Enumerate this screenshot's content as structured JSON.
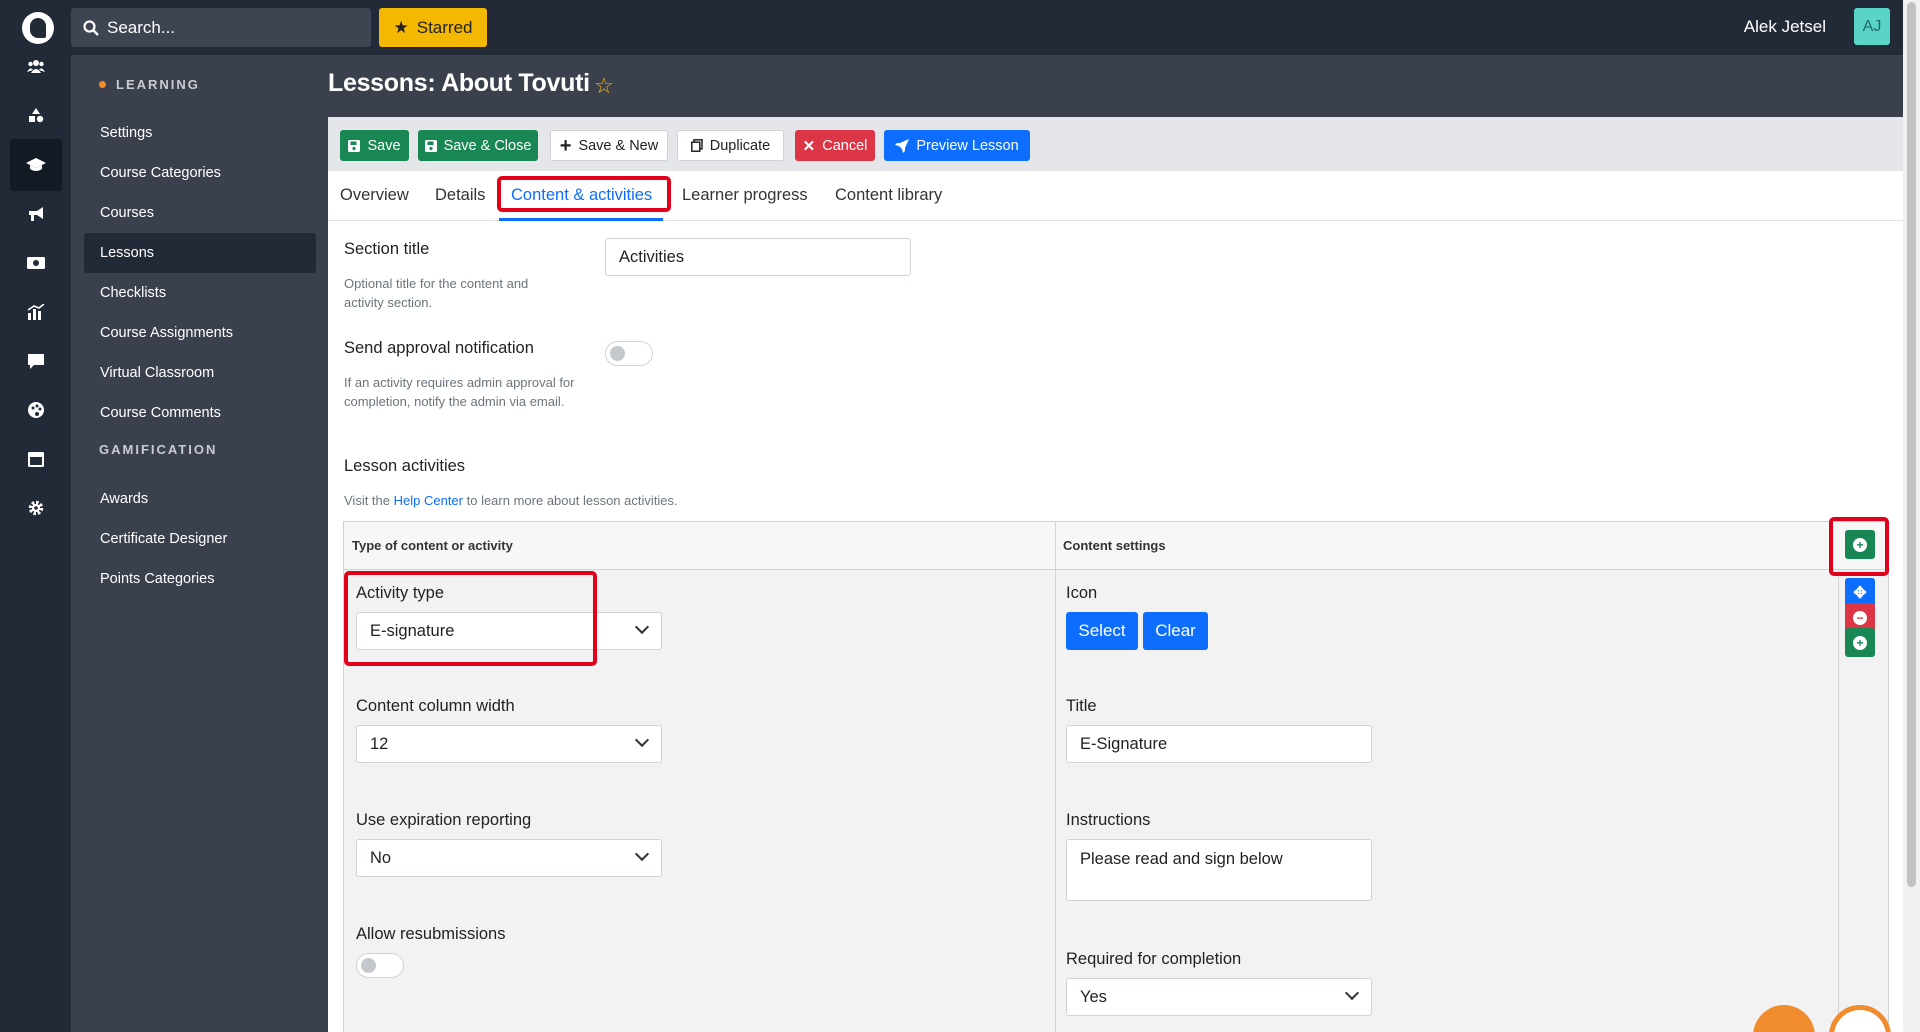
{
  "topbar": {
    "search_placeholder": "Search...",
    "starred_label": "Starred",
    "user_name": "Alek Jetsel",
    "user_initials": "AJ"
  },
  "sidebar": {
    "learning_header": "LEARNING",
    "learning_items": [
      {
        "label": "Settings"
      },
      {
        "label": "Course Categories"
      },
      {
        "label": "Courses"
      },
      {
        "label": "Lessons"
      },
      {
        "label": "Checklists"
      },
      {
        "label": "Course Assignments"
      },
      {
        "label": "Virtual Classroom"
      },
      {
        "label": "Course Comments"
      }
    ],
    "gamification_header": "GAMIFICATION",
    "gamification_items": [
      {
        "label": "Awards"
      },
      {
        "label": "Certificate Designer"
      },
      {
        "label": "Points Categories"
      }
    ],
    "active_item": "Lessons"
  },
  "page": {
    "title": "Lessons: About Tovuti"
  },
  "toolbar": {
    "save": "Save",
    "save_close": "Save & Close",
    "save_new": "Save & New",
    "duplicate": "Duplicate",
    "cancel": "Cancel",
    "preview": "Preview Lesson"
  },
  "tabs": {
    "overview": "Overview",
    "details": "Details",
    "content": "Content & activities",
    "progress": "Learner progress",
    "library": "Content library",
    "active": "Content & activities"
  },
  "form": {
    "section_title_label": "Section title",
    "section_title_help": "Optional title for the content and activity section.",
    "section_title_value": "Activities",
    "approval_label": "Send approval notification",
    "approval_help": "If an activity requires admin approval for completion, notify the admin via email.",
    "approval_on": false,
    "activities_label": "Lesson activities",
    "activities_help_prefix": "Visit the ",
    "activities_help_link": "Help Center",
    "activities_help_suffix": " to learn more about lesson activities."
  },
  "activities_table": {
    "col_type": "Type of content or activity",
    "col_settings": "Content settings",
    "activity_type_label": "Activity type",
    "activity_type_value": "E-signature",
    "column_width_label": "Content column width",
    "column_width_value": "12",
    "expiration_label": "Use expiration reporting",
    "expiration_value": "No",
    "resubmissions_label": "Allow resubmissions",
    "resubmissions_on": false,
    "icon_label": "Icon",
    "icon_select": "Select",
    "icon_clear": "Clear",
    "title_label": "Title",
    "title_value": "E-Signature",
    "instructions_label": "Instructions",
    "instructions_value": "Please read and sign below",
    "required_label": "Required for completion",
    "required_value": "Yes"
  },
  "colors": {
    "topbar": "#232a37",
    "sidebar": "#3a404c",
    "green": "#198754",
    "blue": "#0d6efd",
    "red": "#dc3545",
    "starred": "#f5b800",
    "highlight": "#e0001b"
  }
}
